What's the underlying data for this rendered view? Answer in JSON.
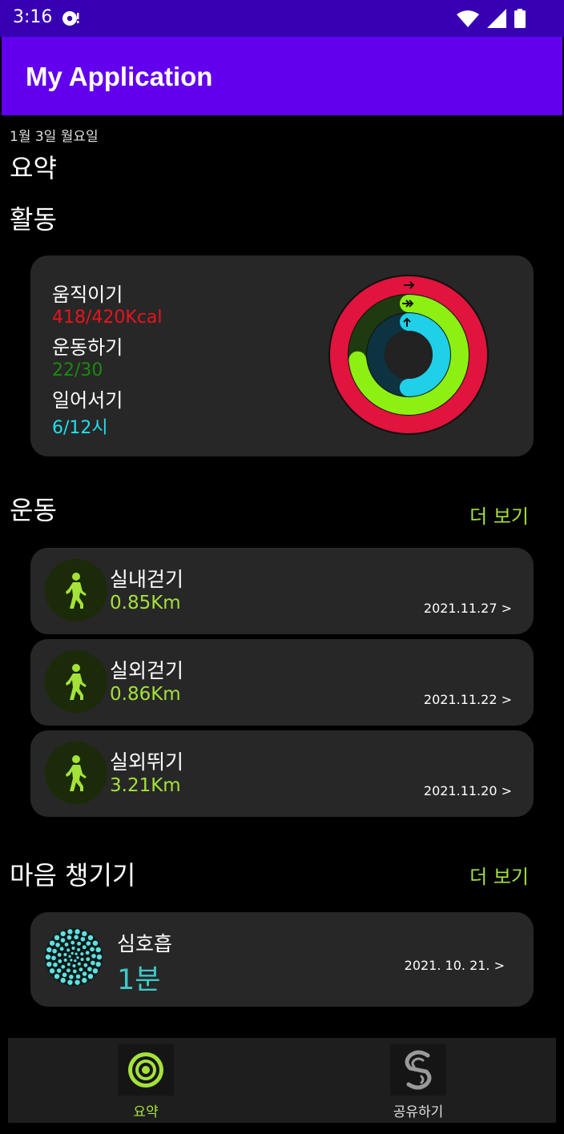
{
  "status_bar": {
    "time": "3:16"
  },
  "app_bar": {
    "title": "My Application"
  },
  "date": "1월 3일 월요일",
  "summary_title": "요약",
  "activity": {
    "title": "활동",
    "move_label": "움직이기",
    "move_value": "418/420Kcal",
    "exercise_label": "운동하기",
    "exercise_value": "22/30",
    "stand_label": "일어서기",
    "stand_value": "6/12시",
    "rings": {
      "move_progress": 0.995,
      "exercise_progress": 0.733,
      "stand_progress": 0.5
    },
    "colors": {
      "move": "#e0143c",
      "exercise": "#8cf013",
      "stand": "#1fd0e8"
    }
  },
  "workouts": {
    "title": "운동",
    "more_label": "더 보기",
    "items": [
      {
        "name": "실내걷기",
        "distance": "0.85Km",
        "date": "2021.11.27 >"
      },
      {
        "name": "실외걷기",
        "distance": "0.86Km",
        "date": "2021.11.22 >"
      },
      {
        "name": "실외뛰기",
        "distance": "3.21Km",
        "date": "2021.11.20 >"
      }
    ]
  },
  "mindfulness": {
    "title": "마음 챙기기",
    "more_label": "더 보기",
    "item": {
      "name": "심호흡",
      "value": "1분",
      "date": "2021. 10. 21. >"
    }
  },
  "bottom_nav": {
    "items": [
      {
        "label": "요약",
        "icon": "activity-rings-icon",
        "active": true
      },
      {
        "label": "공유하기",
        "icon": "sharing-icon",
        "active": false
      }
    ]
  },
  "colors": {
    "accent": "#a4e23a",
    "app_bar": "#6200ee",
    "status_bar": "#3700b3",
    "card": "#272727"
  }
}
